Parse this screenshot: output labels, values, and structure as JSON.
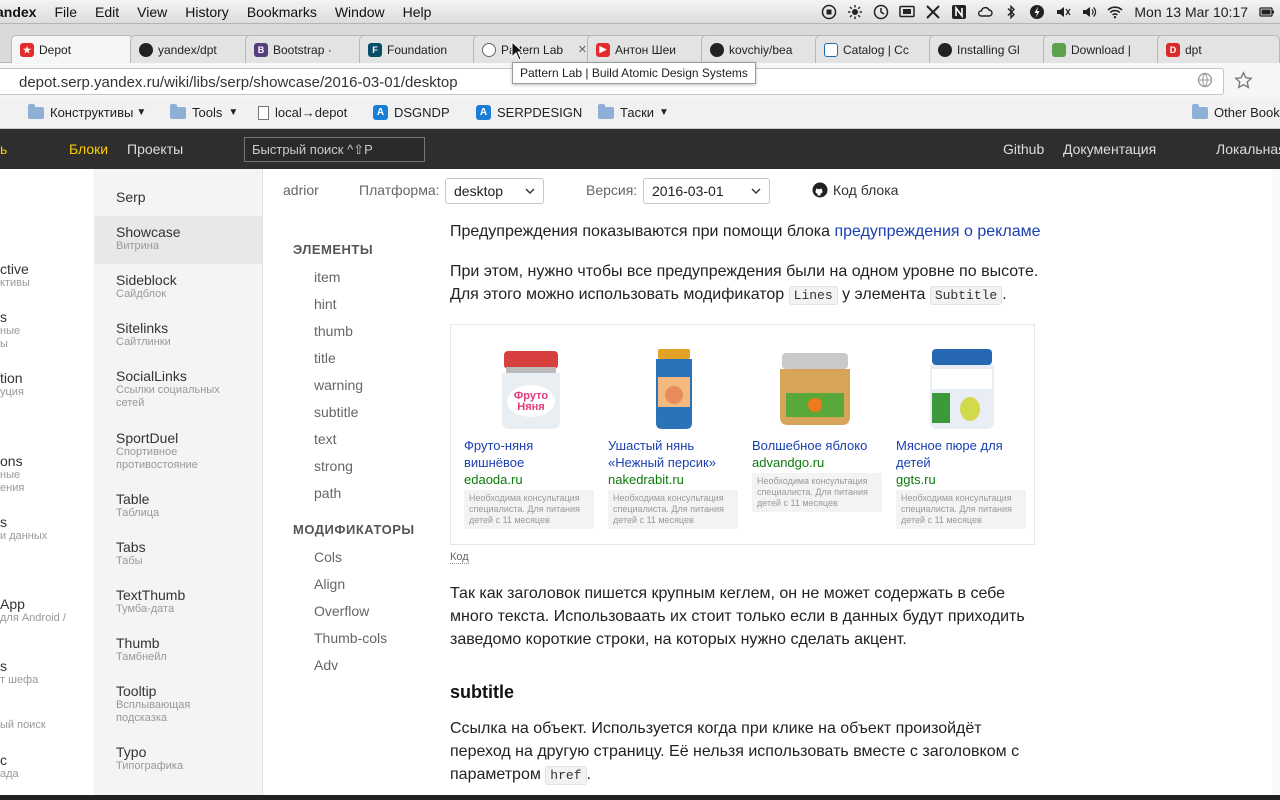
{
  "menubar": {
    "app": "andex",
    "items": [
      "File",
      "Edit",
      "View",
      "History",
      "Bookmarks",
      "Window",
      "Help"
    ],
    "clock": "Mon 13 Mar  10:17"
  },
  "tabs": [
    {
      "label": "Depot",
      "favicon": "yandex-depot-icon",
      "color": "#e52b2b"
    },
    {
      "label": "yandex/dpt",
      "favicon": "github-icon",
      "color": "#222222"
    },
    {
      "label": "Bootstrap ·",
      "favicon": "bootstrap-icon",
      "color": "#563d7c"
    },
    {
      "label": "Foundation",
      "favicon": "foundation-icon",
      "color": "#074e68"
    },
    {
      "label": "Pattern Lab",
      "favicon": "patternlab-icon",
      "color": "#666666"
    },
    {
      "label": "Антон Шеи",
      "favicon": "youtube-icon",
      "color": "#e52b2b"
    },
    {
      "label": "kovchiy/bea",
      "favicon": "github-icon",
      "color": "#222222"
    },
    {
      "label": "Catalog | Cc",
      "favicon": "doc-icon",
      "color": "#1a6fb3"
    },
    {
      "label": "Installing Gl",
      "favicon": "github-icon",
      "color": "#222222"
    },
    {
      "label": "Download |",
      "favicon": "node-icon",
      "color": "#5fa04e"
    },
    {
      "label": "dpt",
      "favicon": "depot-icon",
      "color": "#d92b2b"
    }
  ],
  "tooltip": "Pattern Lab | Build Atomic Design Systems",
  "url": "depot.serp.yandex.ru/wiki/libs/serp/showcase/2016-03-01/desktop",
  "bookmarks": [
    "Конструктивы",
    "Tools",
    "local→depot",
    "DSGNDP",
    "SERPDESIGN",
    "Таски",
    "Other Book"
  ],
  "topnav": {
    "partial": "ь",
    "blocks": "Блоки",
    "projects": "Проекты",
    "search": "Быстрый поиск ^⇧P",
    "github": "Github",
    "docs": "Документация",
    "local": "Локальная"
  },
  "leftcol": [
    {
      "t": "ctive",
      "s": "ктивы"
    },
    {
      "t": "s",
      "s": "ные\nы"
    },
    {
      "t": "tion",
      "s": "уция"
    },
    {
      "t": "ons",
      "s": "ные\nения"
    },
    {
      "t": "s",
      "s": "и данных"
    },
    {
      "t": "App",
      "s": "для Android /"
    },
    {
      "t": "s",
      "s": "т шефа"
    },
    {
      "t": "",
      "s": "ый поиск"
    },
    {
      "t": "c",
      "s": "ада"
    }
  ],
  "sidebar": [
    {
      "t": "Serp",
      "s": ""
    },
    {
      "t": "Showcase",
      "s": "Витрина"
    },
    {
      "t": "Sideblock",
      "s": "Сайдблок"
    },
    {
      "t": "Sitelinks",
      "s": "Сайтлинки"
    },
    {
      "t": "SocialLinks",
      "s": "Ссылки социальных сетей"
    },
    {
      "t": "SportDuel",
      "s": "Спортивное противостояние"
    },
    {
      "t": "Table",
      "s": "Таблица"
    },
    {
      "t": "Tabs",
      "s": "Табы"
    },
    {
      "t": "TextThumb",
      "s": "Тумба-дата"
    },
    {
      "t": "Thumb",
      "s": "Тамбнейл"
    },
    {
      "t": "Tooltip",
      "s": "Всплывающая подсказка"
    },
    {
      "t": "Typo",
      "s": "Типографика"
    }
  ],
  "filter": {
    "author": "adrior",
    "platform_label": "Платформа:",
    "platform_value": "desktop",
    "version_label": "Версия:",
    "version_value": "2016-03-01",
    "code_link": "Код блока"
  },
  "toc": {
    "elements_heading": "ЭЛЕМЕНТЫ",
    "elements": [
      "item",
      "hint",
      "thumb",
      "title",
      "warning",
      "subtitle",
      "text",
      "strong",
      "path"
    ],
    "modifiers_heading": "МОДИФИКАТОРЫ",
    "modifiers": [
      "Cols",
      "Align",
      "Overflow",
      "Thumb-cols",
      "Adv"
    ]
  },
  "content": {
    "p1_text": "Предупреждения показываются при помощи блока ",
    "p1_link": "предупреждения о рекламе",
    "p2_line1": "При этом, нужно чтобы все предупреждения были на одном уровне по высоте.",
    "p2_line2a": "Для этого можно использовать модификатор ",
    "p2_code1": "Lines",
    "p2_line2b": " у элемента ",
    "p2_code2": "Subtitle",
    "p2_line2c": ".",
    "kod": "Код",
    "p3_line1": "Так как заголовок пишется крупным кеглем, он не может содержать в себе",
    "p3_line2": "много текста. Использоваать их стоит только если в данных будут приходить",
    "p3_line3": "заведомо короткие строки, на которых нужно сделать акцент.",
    "h_subtitle": "subtitle",
    "p4_line1": "Ссылка на объект. Используется когда при клике на объект произойдёт",
    "p4_line2": "переход на другую страницу. Её нельзя использовать вместе с заголовком с",
    "p4_line3a": "параметром ",
    "p4_code": "href",
    "p4_line3b": "."
  },
  "cards": [
    {
      "title1": "Фруто-няня",
      "title2": "вишнёвое",
      "site": "edaoda.ru",
      "warn": [
        "Необходима консультация",
        "специалиста. Для питания",
        "детей с 11 месяцев"
      ]
    },
    {
      "title1": "Ушастый нянь",
      "title2": "«Нежный персик»",
      "site": "nakedrabit.ru",
      "warn": [
        "Необходима консультация",
        "специалиста. Для питания",
        "детей с 11 месяцев"
      ]
    },
    {
      "title1": "Волшебное яблоко",
      "title2": "",
      "site": "advandgo.ru",
      "warn": [
        "Необходима консультация",
        "специалиста. Для питания",
        "детей с 11 месяцев"
      ]
    },
    {
      "title1": "Мясное пюре для",
      "title2": "детей",
      "site": "ggts.ru",
      "warn": [
        "Необходима консультация",
        "специалиста. Для питания",
        "детей с 11 месяцев"
      ]
    }
  ]
}
